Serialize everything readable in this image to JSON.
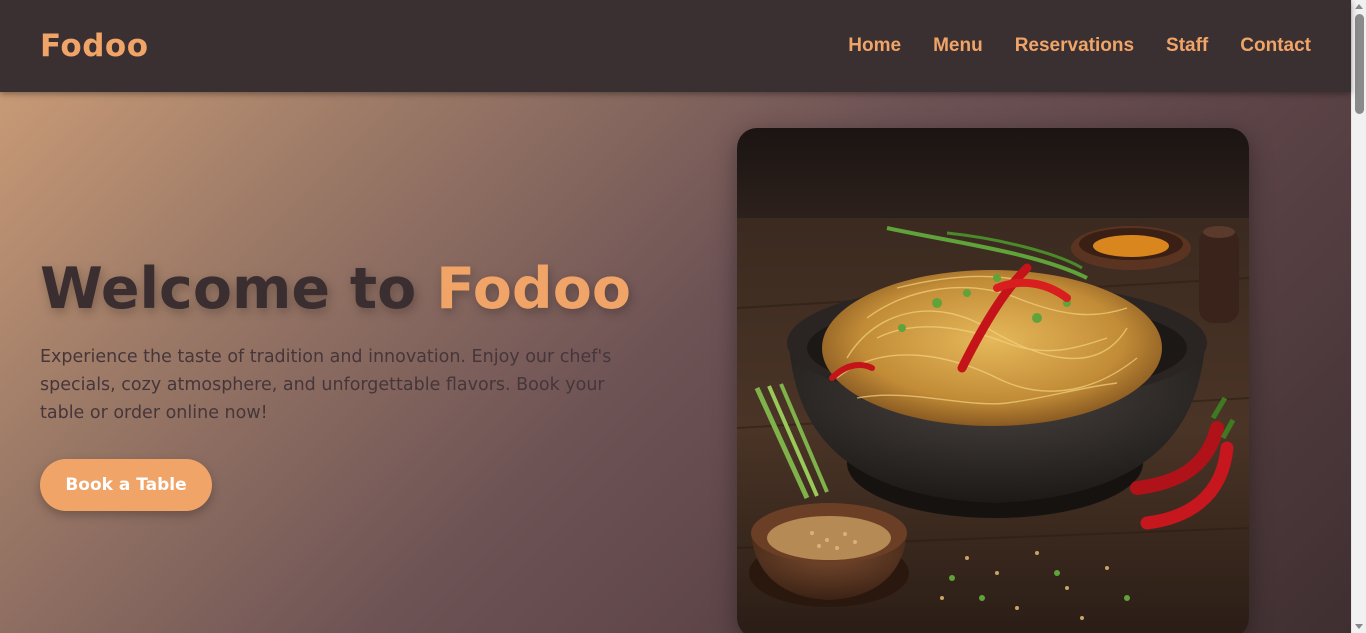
{
  "brand": {
    "logo_text": "Fodoo",
    "accent_color": "#f0a468",
    "dark_color": "#3a2e30"
  },
  "nav": {
    "items": [
      {
        "label": "Home"
      },
      {
        "label": "Menu"
      },
      {
        "label": "Reservations"
      },
      {
        "label": "Staff"
      },
      {
        "label": "Contact"
      }
    ]
  },
  "hero": {
    "title_prefix": "Welcome to ",
    "title_accent": "Fodoo",
    "description": "Experience the taste of tradition and innovation. Enjoy our chef's specials, cozy atmosphere, and unforgettable flavors. Book your table or order online now!",
    "cta_label": "Book a Table",
    "image_alt": "Bowl of noodles with red chili peppers and green onions"
  }
}
